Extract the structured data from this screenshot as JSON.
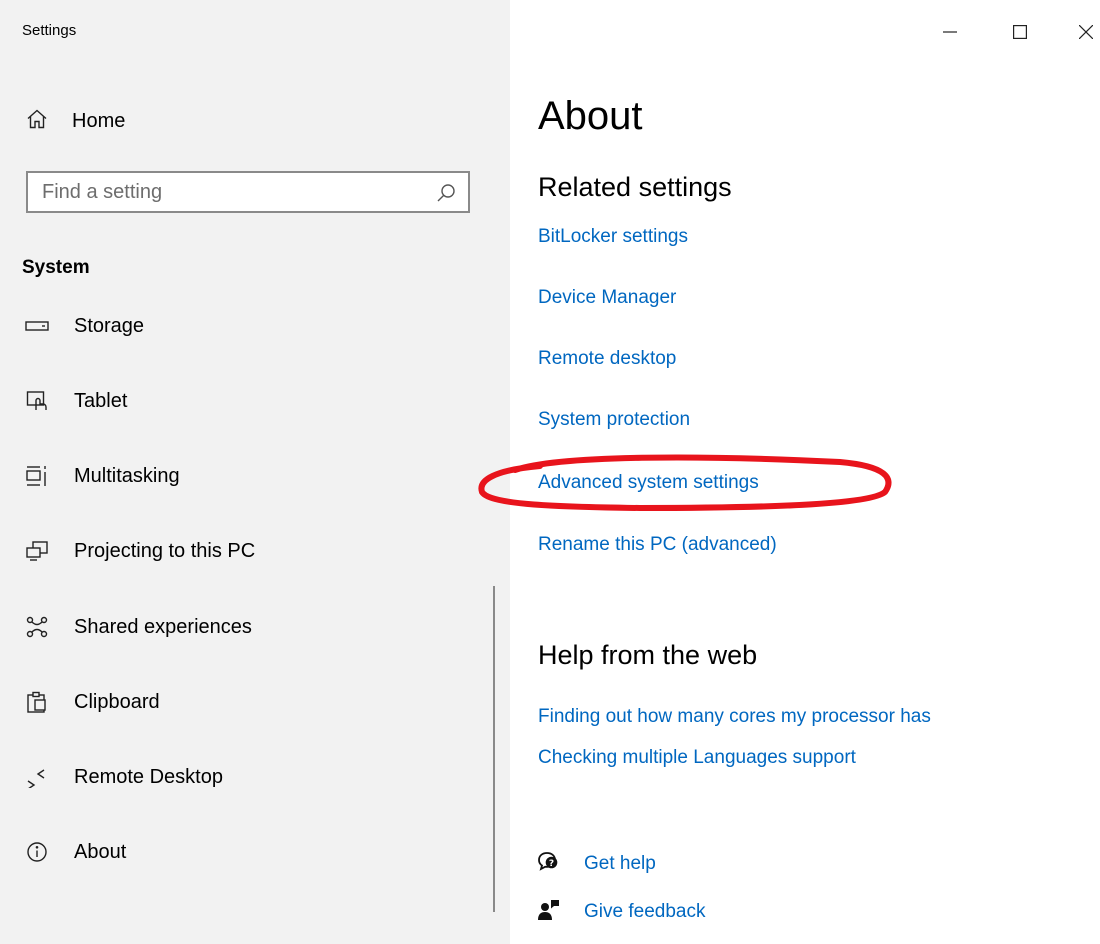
{
  "window": {
    "title": "Settings",
    "controls": [
      "minimize-icon",
      "maximize-icon",
      "close-icon"
    ]
  },
  "sidebar": {
    "home_label": "Home",
    "search_placeholder": "Find a setting",
    "section_title": "System",
    "items": [
      {
        "label": "Storage",
        "icon": "storage-icon"
      },
      {
        "label": "Tablet",
        "icon": "tablet-icon"
      },
      {
        "label": "Multitasking",
        "icon": "multitasking-icon"
      },
      {
        "label": "Projecting to this PC",
        "icon": "projecting-icon"
      },
      {
        "label": "Shared experiences",
        "icon": "shared-experiences-icon"
      },
      {
        "label": "Clipboard",
        "icon": "clipboard-icon"
      },
      {
        "label": "Remote Desktop",
        "icon": "remote-desktop-icon"
      },
      {
        "label": "About",
        "icon": "info-icon"
      }
    ]
  },
  "main": {
    "title": "About",
    "related": {
      "heading": "Related settings",
      "links": [
        "BitLocker settings",
        "Device Manager",
        "Remote desktop",
        "System protection",
        "Advanced system settings",
        "Rename this PC (advanced)"
      ]
    },
    "help": {
      "heading": "Help from the web",
      "links": [
        "Finding out how many cores my processor has",
        "Checking multiple Languages support"
      ]
    },
    "support": {
      "get_help": "Get help",
      "give_feedback": "Give feedback"
    }
  },
  "colors": {
    "link": "#0067c0",
    "sidebar_bg": "#f2f2f2",
    "annotation": "#e8141c"
  }
}
